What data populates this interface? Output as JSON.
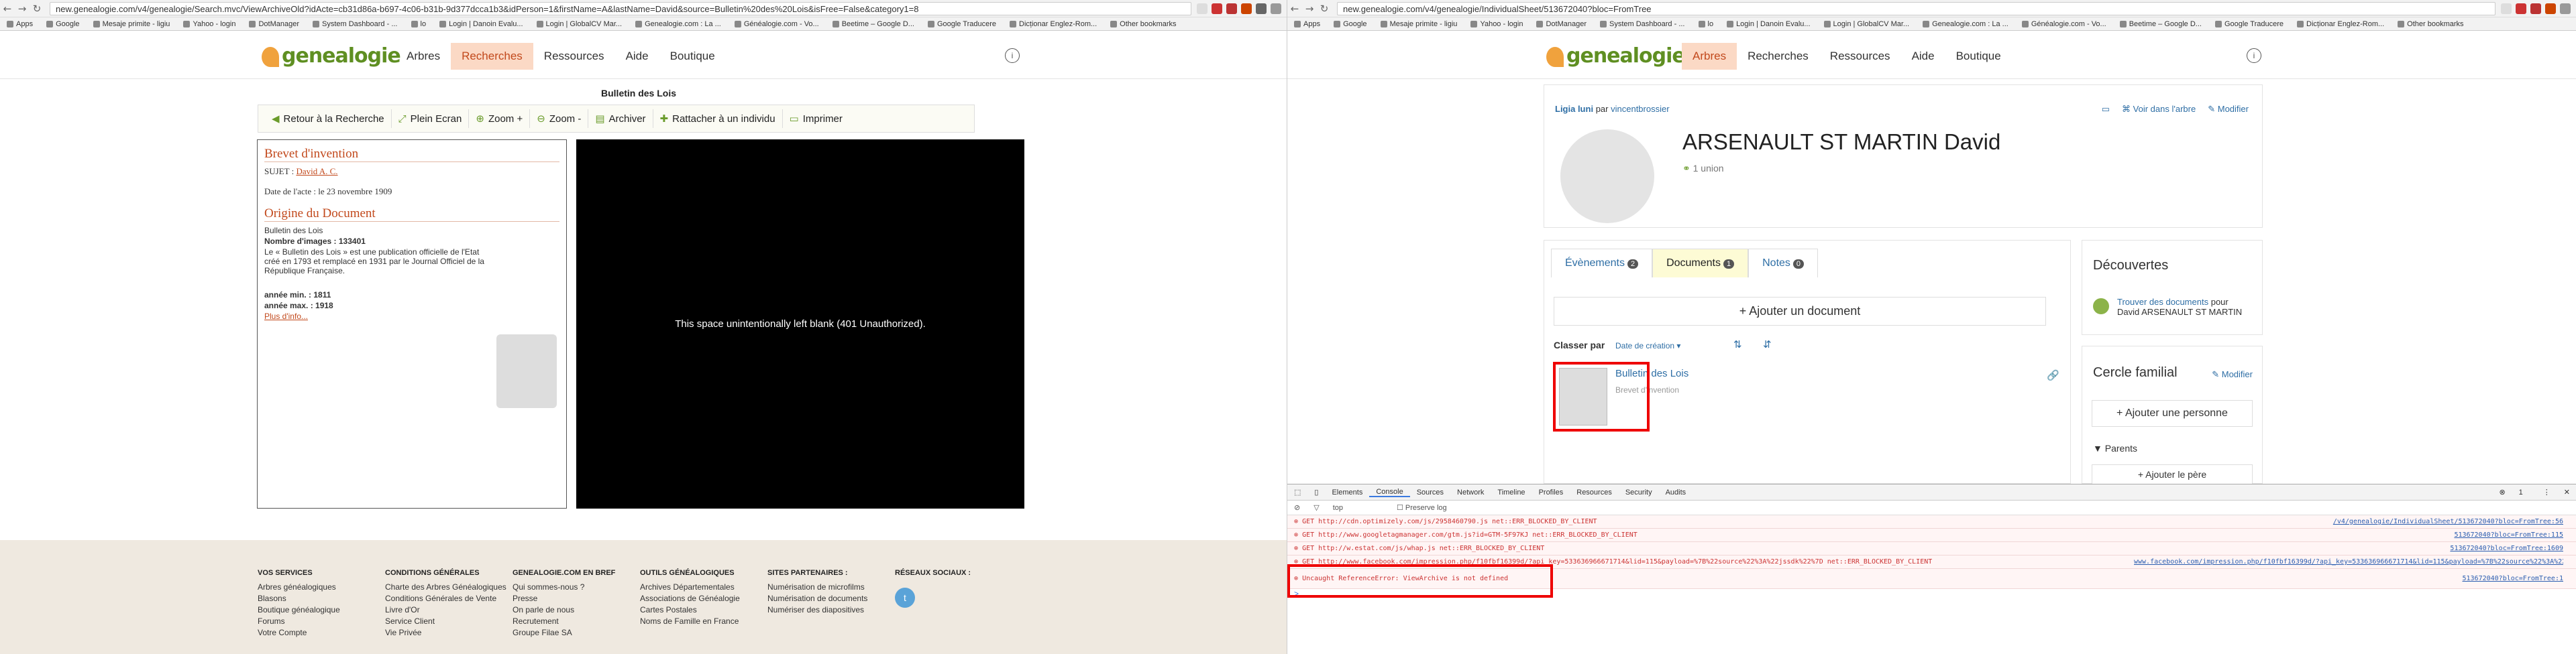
{
  "left": {
    "url": "new.genealogie.com/v4/genealogie/Search.mvc/ViewArchiveOld?idActe=cb31d86a-b697-4c06-b31b-9d377dcca1b3&idPerson=1&firstName=A&lastName=David&source=Bulletin%20des%20Lois&isFree=False&category1=8",
    "bookmarks": [
      "Apps",
      "Google",
      "Mesaje primite - ligiu",
      "Yahoo - login",
      "DotManager",
      "System Dashboard - ...",
      "lo",
      "Login | Danoin Evalu...",
      "Login | GlobalCV Mar...",
      "Genealogie.com : La ...",
      "Généalogie.com - Vo...",
      "Beetime – Google D...",
      "Google Traducere",
      "Dicționar Englez-Rom...",
      "Other bookmarks"
    ],
    "nav": [
      "Arbres",
      "Recherches",
      "Ressources",
      "Aide",
      "Boutique"
    ],
    "doc_title": "Bulletin des Lois",
    "toolbar": [
      "Retour à la Recherche",
      "Plein Ecran",
      "Zoom +",
      "Zoom -",
      "Archiver",
      "Rattacher à un individu",
      "Imprimer"
    ],
    "panel": {
      "h1": "Brevet d'invention",
      "sujet_label": "SUJET :",
      "sujet_value": "David A. C.",
      "date": "Date de l'acte : le 23 novembre 1909",
      "h2": "Origine du Document",
      "src_name": "Bulletin des Lois",
      "images": "Nombre d'images : 133401",
      "desc": "Le « Bulletin des Lois » est une publication officielle de l'Etat créé en 1793 et remplacé en 1931 par le Journal Officiel de la République Française.",
      "annee_min": "année min. : 1811",
      "annee_max": "année max. : 1918",
      "more": "Plus d'info..."
    },
    "viewer_text": "This space unintentionally left blank (401 Unauthorized).",
    "footer": [
      {
        "head": "VOS SERVICES",
        "items": [
          "Arbres généalogiques",
          "Blasons",
          "Boutique généalogique",
          "Forums",
          "Votre Compte"
        ]
      },
      {
        "head": "CONDITIONS GÉNÉRALES",
        "items": [
          "Charte des Arbres Généalogiques",
          "Conditions Générales de Vente",
          "Livre d'Or",
          "Service Client",
          "Vie Privée"
        ]
      },
      {
        "head": "GENEALOGIE.COM EN BREF",
        "items": [
          "Qui sommes-nous ?",
          "Presse",
          "On parle de nous",
          "Recrutement",
          "Groupe Filae SA"
        ]
      },
      {
        "head": "OUTILS GÉNÉALOGIQUES",
        "items": [
          "Archives Départementales",
          "Associations de Généalogie",
          "Cartes Postales",
          "Noms de Famille en France"
        ]
      },
      {
        "head": "SITES PARTENAIRES :",
        "items": [
          "Numérisation de microfilms",
          "Numérisation de documents",
          "Numériser des diapositives"
        ]
      },
      {
        "head": "RÉSEAUX SOCIAUX :",
        "items": []
      }
    ]
  },
  "right": {
    "url": "new.genealogie.com/v4/genealogie/IndividualSheet/513672040?bloc=FromTree",
    "nav": [
      "Arbres",
      "Recherches",
      "Ressources",
      "Aide",
      "Boutique"
    ],
    "owner_user": "Ligia luni",
    "owner_par": "par",
    "owner_link": "vincentbrossier",
    "voir_arbre": "Voir dans l'arbre",
    "modifier": "Modifier",
    "person_name": "ARSENAULT ST MARTIN David",
    "unions": "1 union",
    "tabs": [
      {
        "label": "Évènements",
        "count": "2"
      },
      {
        "label": "Documents",
        "count": "1"
      },
      {
        "label": "Notes",
        "count": "0"
      }
    ],
    "add_document": "+ Ajouter un document",
    "sort_label": "Classer par",
    "sort_value": "Date de création",
    "doc_title": "Bulletin des Lois",
    "doc_sub": "Brevet d'invention",
    "decouvertes": "Découvertes",
    "disc_link": "Trouver des documents",
    "disc_text": "pour David ARSENAULT ST MARTIN",
    "cercle": "Cercle familial",
    "cercle_modifier": "Modifier",
    "add_person": "+ Ajouter une personne",
    "parents": "Parents",
    "add_parent": "+ Ajouter le père",
    "devtools_tabs": [
      "Elements",
      "Console",
      "Sources",
      "Network",
      "Timeline",
      "Profiles",
      "Resources",
      "Security",
      "Audits"
    ],
    "filter_top": "top",
    "preserve": "Preserve log",
    "error_count": "1",
    "console": [
      {
        "text": "GET http://cdn.optimizely.com/js/2958460790.js net::ERR_BLOCKED_BY_CLIENT",
        "src": "/v4/genealogie/IndividualSheet/513672040?bloc=FromTree:56"
      },
      {
        "text": "GET http://www.googletagmanager.com/gtm.js?id=GTM-5F97KJ net::ERR_BLOCKED_BY_CLIENT",
        "src": "513672040?bloc=FromTree:115"
      },
      {
        "text": "GET http://w.estat.com/js/whap.js net::ERR_BLOCKED_BY_CLIENT",
        "src": "513672040?bloc=FromTree:1609"
      },
      {
        "text": "GET http://www.facebook.com/impression.php/f10fbf16399d/?api_key=533636966671714&lid=115&payload=%7B%22source%22%3A%22jssdk%22%7D net::ERR_BLOCKED_BY_CLIENT",
        "src": "www.facebook.com/impression.php/f10fbf16399d/?api_key=533636966671714&lid=115&payload=%7B%22source%22%3A%22jssdk%22%7D:1"
      },
      {
        "text": "Uncaught ReferenceError: ViewArchive is not defined",
        "src": "513672040?bloc=FromTree:1"
      }
    ]
  }
}
